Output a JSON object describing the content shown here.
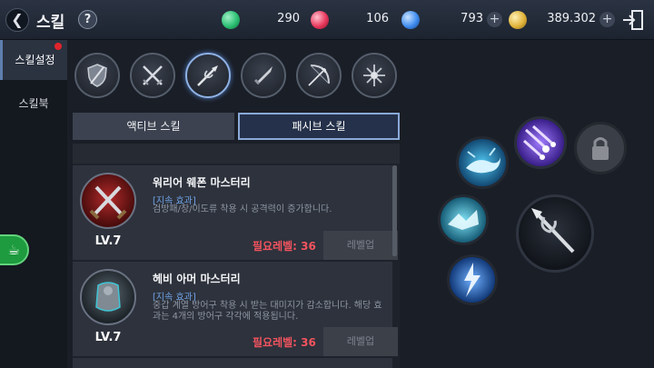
{
  "header": {
    "back_icon": "chevron-left-icon",
    "title": "스킬",
    "help_label": "?",
    "currencies": [
      {
        "name": "green-gem-icon",
        "color": "#2bbf73",
        "amount": "290"
      },
      {
        "name": "red-gem-icon",
        "color": "#e8385c",
        "amount": "106"
      },
      {
        "name": "blue-gem-icon",
        "color": "#3f8df0",
        "amount": "793"
      },
      {
        "name": "gold-coin-icon",
        "color": "#e1b43a",
        "amount": "389.302"
      }
    ],
    "plus_label": "+",
    "exit_icon": "exit-door-icon"
  },
  "sidebar": {
    "items": [
      {
        "label": "스킬설정",
        "active": true
      },
      {
        "label": "스킬북",
        "active": false
      }
    ],
    "coffee_icon": "coffee-cup-icon"
  },
  "weapons": [
    {
      "icon": "shield-icon",
      "active": false
    },
    {
      "icon": "crossed-swords-icon",
      "active": false
    },
    {
      "icon": "spear-icon",
      "active": true
    },
    {
      "icon": "dagger-icon",
      "active": false
    },
    {
      "icon": "bow-icon",
      "active": false
    },
    {
      "icon": "orb-icon",
      "active": false
    }
  ],
  "categories": {
    "active_skill": "액티브 스킬",
    "passive_skill": "패시브 스킬",
    "selected": "패시브 스킬"
  },
  "skills": [
    {
      "name": "워리어 웨폰 마스터리",
      "level": "LV.7",
      "tag": "[지속 효과]",
      "description": "검방패/창/이도류 착용 시 공격력이 증가합니다.",
      "required": "필요레벨: 36",
      "button": "레벨업",
      "icon": "crossed-blades-skill-icon"
    },
    {
      "name": "헤비 아머 마스터리",
      "level": "LV.7",
      "tag": "[지속 효과]",
      "description": "중갑 계열 방어구 착용 시 받는 대미지가 감소합니다. 해당 효과는 4개의 방어구 각각에 적용됩니다.",
      "required": "필요레벨: 36",
      "button": "레벨업",
      "icon": "armor-skill-icon"
    }
  ],
  "slots": {
    "main": "spear-icon",
    "list": [
      {
        "name": "meteor-skill-icon",
        "color": "#7b4fe0"
      },
      {
        "name": "lock-icon",
        "color": "#8a8d94"
      },
      {
        "name": "whale-skill-icon",
        "color": "#2f9fd6"
      },
      {
        "name": "ice-wave-skill-icon",
        "color": "#3fb4d8"
      },
      {
        "name": "lightning-skill-icon",
        "color": "#3a86e6"
      }
    ]
  }
}
